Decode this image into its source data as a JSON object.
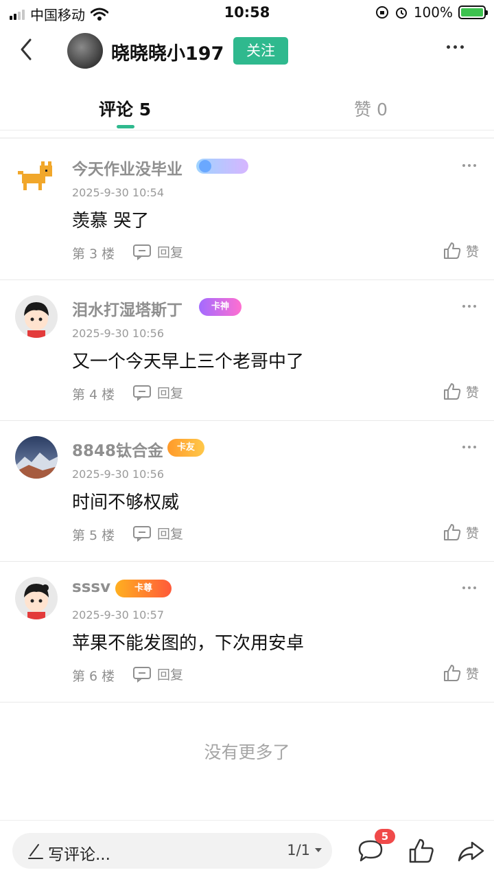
{
  "status_bar": {
    "carrier": "中国移动",
    "time": "10:58",
    "battery": "100%"
  },
  "header": {
    "username": "晓晓晓小197",
    "follow_label": "关注"
  },
  "tabs": {
    "comments": "评论 5",
    "likes": "赞 0"
  },
  "comments": [
    {
      "name": "今天作业没毕业",
      "time": "2025-9-30 10:54",
      "text": "羡慕 哭了",
      "floor": "第 3 楼",
      "reply": "回复",
      "like": "赞",
      "badge": ""
    },
    {
      "name": "泪水打湿塔斯丁",
      "time": "2025-9-30 10:56",
      "text": "又一个今天早上三个老哥中了",
      "floor": "第 4 楼",
      "reply": "回复",
      "like": "赞",
      "badge": "卡神"
    },
    {
      "name": "8848钛合金",
      "time": "2025-9-30 10:56",
      "text": "时间不够权威",
      "floor": "第 5 楼",
      "reply": "回复",
      "like": "赞",
      "badge": "卡友"
    },
    {
      "name": "sssv",
      "time": "2025-9-30 10:57",
      "text": "苹果不能发图的，下次用安卓",
      "floor": "第 6 楼",
      "reply": "回复",
      "like": "赞",
      "badge": "卡尊"
    }
  ],
  "footer": {
    "no_more": "没有更多了"
  },
  "bottom_bar": {
    "placeholder": "写评论...",
    "page": "1/1",
    "comment_count": "5"
  },
  "colors": {
    "accent": "#2fb98e",
    "badge_red": "#f04a4a"
  }
}
